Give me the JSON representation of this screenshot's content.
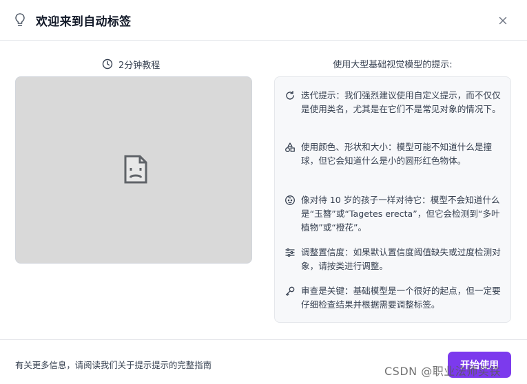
{
  "header": {
    "title": "欢迎来到自动标签"
  },
  "tutorial": {
    "label": "2分钟教程"
  },
  "tips": {
    "title": "使用大型基础视觉模型的提示:",
    "items": [
      {
        "icon": "refresh-icon",
        "text": "迭代提示：我们强烈建议使用自定义提示，而不仅仅是使用类名，尤其是在它们不是常见对象的情况下。"
      },
      {
        "icon": "shapes-icon",
        "text": "使用颜色、形状和大小：模型可能不知道什么是撞球，但它会知道什么是小的圆形红色物体。"
      },
      {
        "icon": "child-face-icon",
        "text": "像对待 10 岁的孩子一样对待它：模型不会知道什么是“玉簪”或“Tagetes erecta”，但它会检测到“多叶植物”或“橙花”。"
      },
      {
        "icon": "sliders-icon",
        "text": "调整置信度：如果默认置信度阈值缺失或过度检测对象，请按类进行调整。"
      },
      {
        "icon": "key-icon",
        "text": "审查是关键：基础模型是一个很好的起点，但一定要仔细检查结果并根据需要调整标签。"
      }
    ]
  },
  "footer": {
    "info": "有关更多信息，请阅读我们关于提示提示的完整指南",
    "start_button": "开始使用"
  },
  "watermark": "CSDN @职业法师买铁",
  "colors": {
    "accent": "#7c3aed",
    "video_bg": "#d9d9d9",
    "tips_bg": "#f7f8fa"
  }
}
